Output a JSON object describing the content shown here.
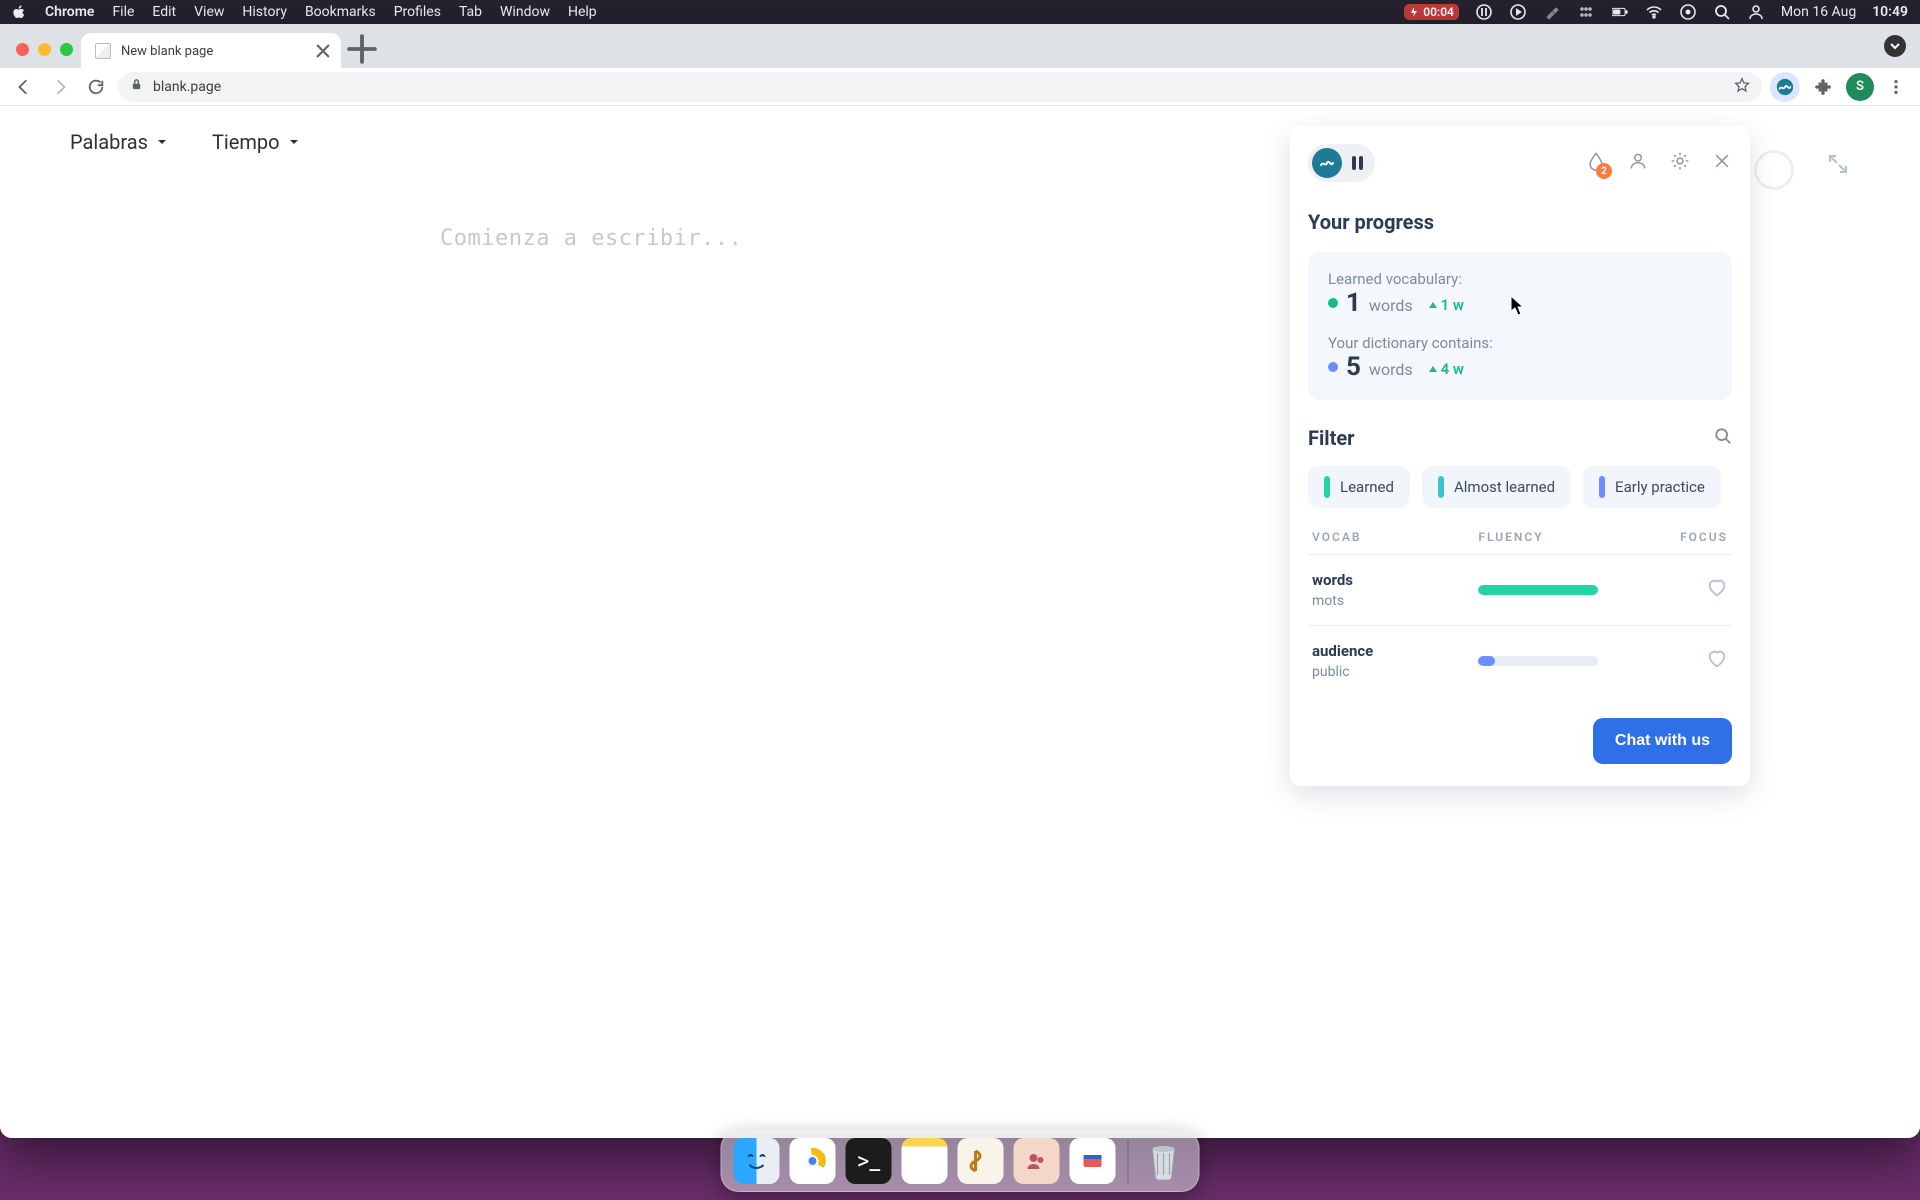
{
  "menubar": {
    "app": "Chrome",
    "items": [
      "File",
      "Edit",
      "View",
      "History",
      "Bookmarks",
      "Profiles",
      "Tab",
      "Window",
      "Help"
    ],
    "timer": "00:04",
    "date": "Mon 16 Aug",
    "time": "10:49"
  },
  "tabs": {
    "active_title": "New blank page"
  },
  "urlbar": {
    "url": "blank.page",
    "profile_initial": "S"
  },
  "page": {
    "dropdowns": {
      "words_label": "Palabras",
      "time_label": "Tiempo"
    },
    "placeholder": "Comienza a escribir..."
  },
  "panel": {
    "notifications_count": "2",
    "section_progress_title": "Your progress",
    "learned_label": "Learned vocabulary:",
    "learned_count": "1",
    "learned_unit": "words",
    "learned_delta": "1 w",
    "dict_label": "Your dictionary contains:",
    "dict_count": "5",
    "dict_unit": "words",
    "dict_delta": "4 w",
    "filter_title": "Filter",
    "chips": {
      "learned": "Learned",
      "almost": "Almost learned",
      "early": "Early practice"
    },
    "headers": {
      "vocab": "VOCAB",
      "fluency": "FLUENCY",
      "focus": "FOCUS"
    },
    "rows": [
      {
        "word": "words",
        "translation": "mots",
        "fluency": "full"
      },
      {
        "word": "audience",
        "translation": "public",
        "fluency": "low"
      }
    ],
    "chat_button": "Chat with us"
  },
  "dock": {
    "apps": [
      "finder",
      "chrome",
      "terminal",
      "notes",
      "script",
      "users",
      "tickets",
      "clock"
    ],
    "trash": "trash"
  }
}
